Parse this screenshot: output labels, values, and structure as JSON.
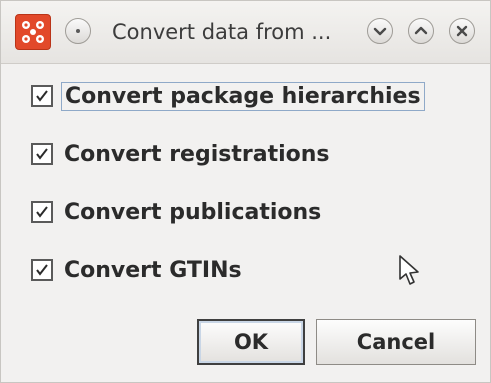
{
  "window": {
    "title": "Convert data from ...",
    "app_icon": "app-logo-icon",
    "controls": [
      "menu-icon",
      "minimize-icon",
      "maximize-icon",
      "close-icon"
    ]
  },
  "options": [
    {
      "label": "Convert package hierarchies",
      "checked": true
    },
    {
      "label": "Convert registrations",
      "checked": true
    },
    {
      "label": "Convert publications",
      "checked": true
    },
    {
      "label": "Convert GTINs",
      "checked": true
    }
  ],
  "buttons": {
    "ok_label": "OK",
    "cancel_label": "Cancel"
  },
  "colors": {
    "app_icon_bg": "#e2492a",
    "focus_border": "#8fa9c8"
  }
}
